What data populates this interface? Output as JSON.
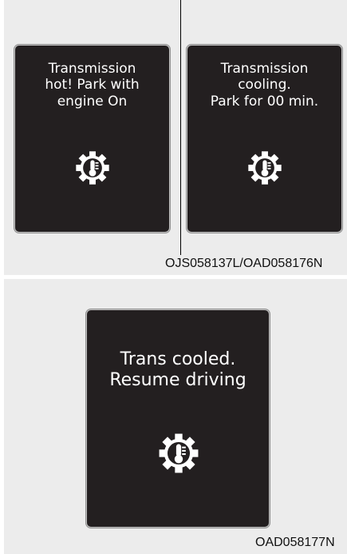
{
  "panels": [
    {
      "screens": [
        {
          "lines": [
            "Transmission",
            "hot! Park with",
            "engine On"
          ],
          "icon": "transmission-temperature-icon"
        },
        {
          "lines": [
            "Transmission",
            "cooling.",
            "Park for 00 min."
          ],
          "icon": "transmission-temperature-icon"
        }
      ],
      "code": "OJS058137L/OAD058176N"
    },
    {
      "screens": [
        {
          "lines": [
            "Trans cooled.",
            "Resume driving"
          ],
          "icon": "transmission-temperature-icon"
        }
      ],
      "code": "OAD058177N"
    }
  ],
  "colors": {
    "panel_background": "#ececec",
    "screen_background": "#231f20",
    "text": "#ffffff"
  }
}
